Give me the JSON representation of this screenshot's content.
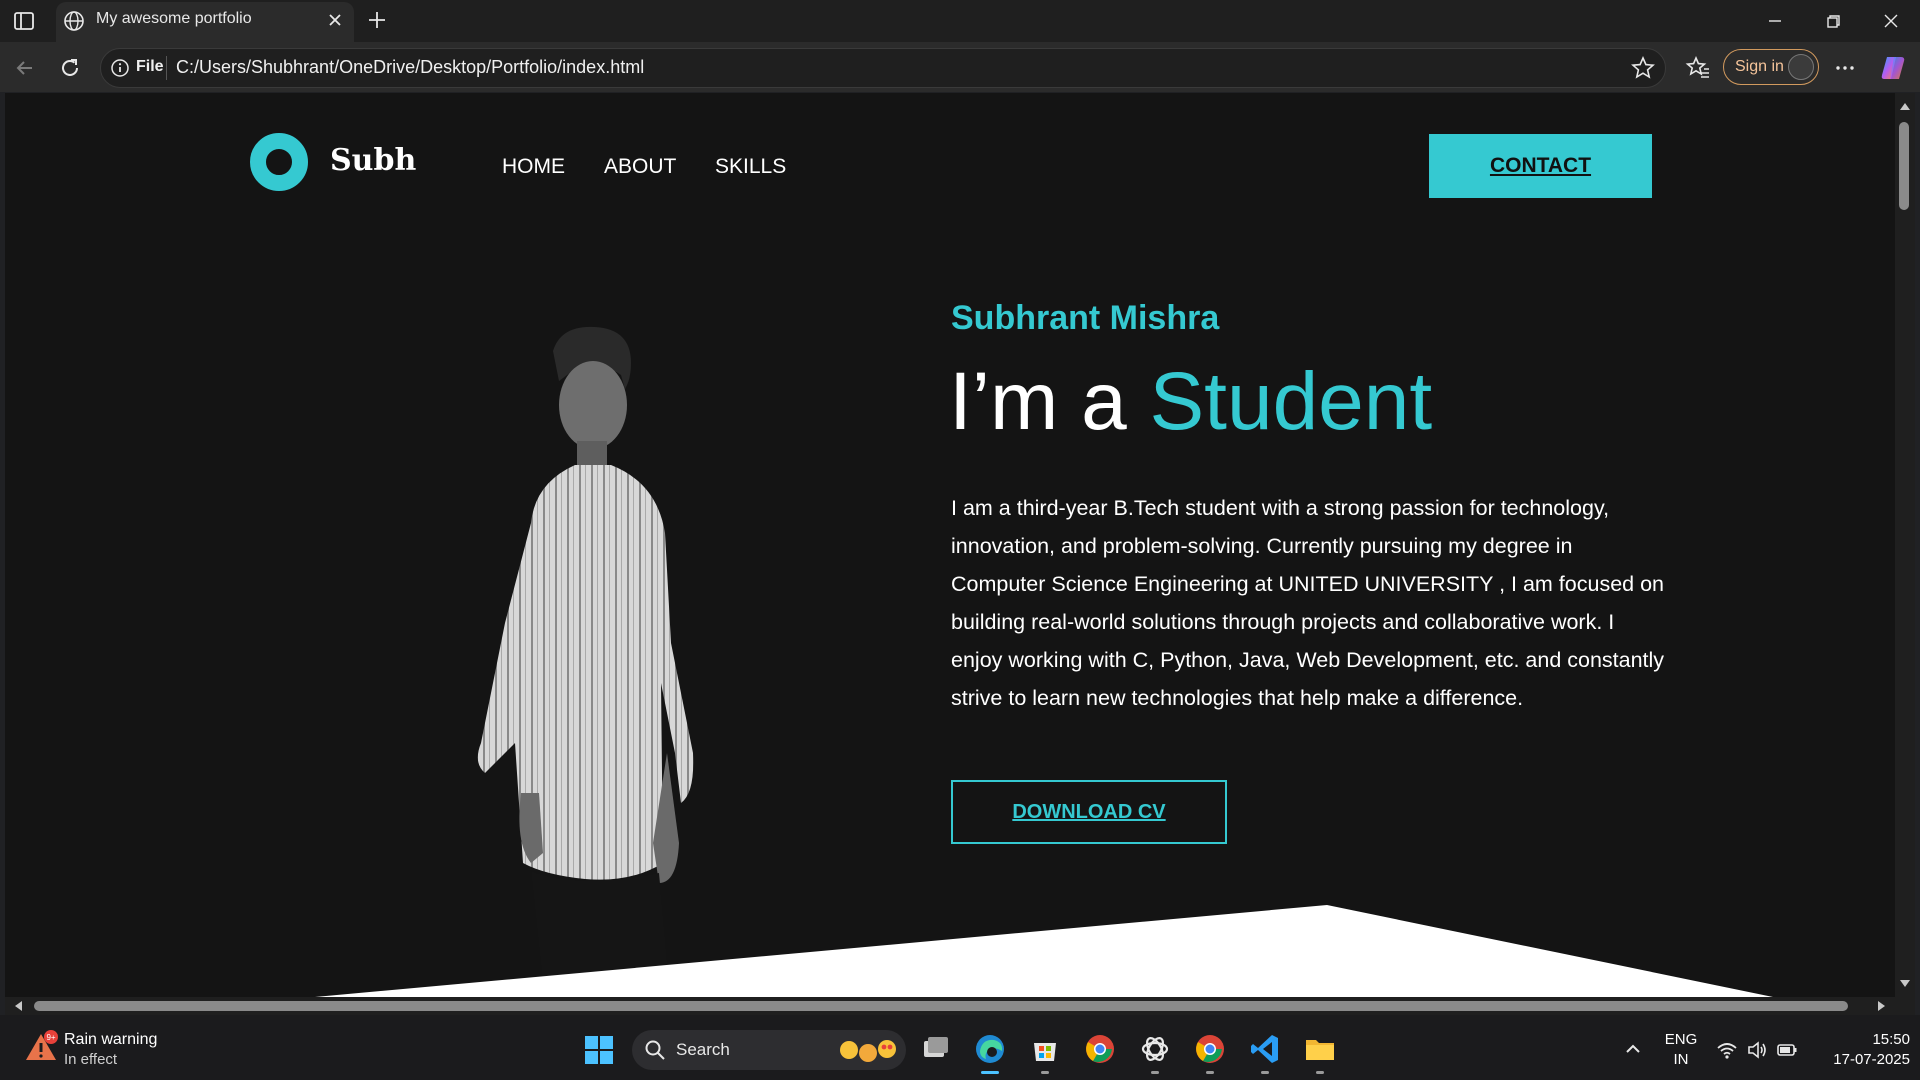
{
  "browser": {
    "tab_title": "My awesome portfolio",
    "address_scheme": "File",
    "url": "C:/Users/Shubhrant/OneDrive/Desktop/Portfolio/index.html",
    "sign_in_label": "Sign in"
  },
  "site": {
    "logo_text": "Subh",
    "nav": [
      "HOME",
      "ABOUT",
      "SKILLS"
    ],
    "contact_label": "CONTACT",
    "name": "Subhrant Mishra",
    "headline_prefix": "I’m a ",
    "headline_accent": "Student",
    "bio": "I am a third-year B.Tech student with a strong passion for technology, innovation, and problem-solving. Currently pursuing my degree in Computer Science Engineering at UNITED UNIVERSITY , I am focused on building real-world solutions through projects and collaborative work. I enjoy working with C, Python, Java, Web Development, etc. and constantly strive to learn new technologies that help make a difference.",
    "cv_label": "DOWNLOAD CV",
    "accent_color": "#35c9d1",
    "background_color": "#141414"
  },
  "taskbar": {
    "weather_title": "Rain warning",
    "weather_sub": "In effect",
    "weather_badge": "9+",
    "search_label": "Search",
    "language_line1": "ENG",
    "language_line2": "IN",
    "time": "15:50",
    "date": "17-07-2025"
  }
}
